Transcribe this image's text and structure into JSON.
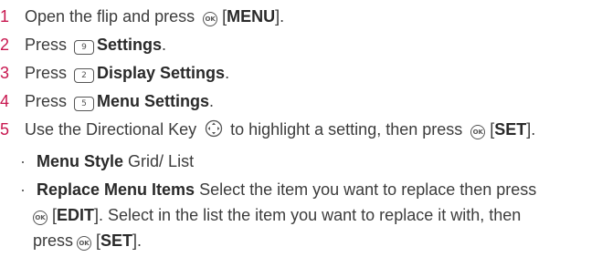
{
  "steps": [
    {
      "num": "1",
      "pre": "Open the flip and press",
      "bracket_open": "[",
      "bold": "MENU",
      "bracket_close": "]."
    },
    {
      "num": "2",
      "pre": "Press",
      "key": "9",
      "bold": "Settings",
      "post": "."
    },
    {
      "num": "3",
      "pre": "Press",
      "key": "2",
      "bold": "Display Settings",
      "post": "."
    },
    {
      "num": "4",
      "pre": "Press",
      "key": "5",
      "bold": "Menu Settings",
      "post": "."
    },
    {
      "num": "5",
      "pre": "Use the Directional Key",
      "mid": "to highlight a setting, then press",
      "bracket_open": "[",
      "bold": "SET",
      "bracket_close": "]."
    }
  ],
  "sub_items": [
    {
      "bullet": "·",
      "bold": "Menu Style",
      "text": "Grid/ List"
    },
    {
      "bullet": "·",
      "bold": "Replace Menu Items",
      "text": "Select the item you want to replace then press",
      "line2_open": "[",
      "line2_bold": "EDIT",
      "line2_text": "]. Select in the list the item you want to replace it with, then",
      "line3_pre": "press",
      "line3_open": "[",
      "line3_bold": "SET",
      "line3_close": "]."
    }
  ],
  "icons": {
    "ok": "ok-key-icon",
    "menu_key": "numbered-key-icon",
    "directional": "directional-key-icon"
  },
  "colors": {
    "step_number": "#c8174f",
    "text": "#3c3c3c"
  }
}
